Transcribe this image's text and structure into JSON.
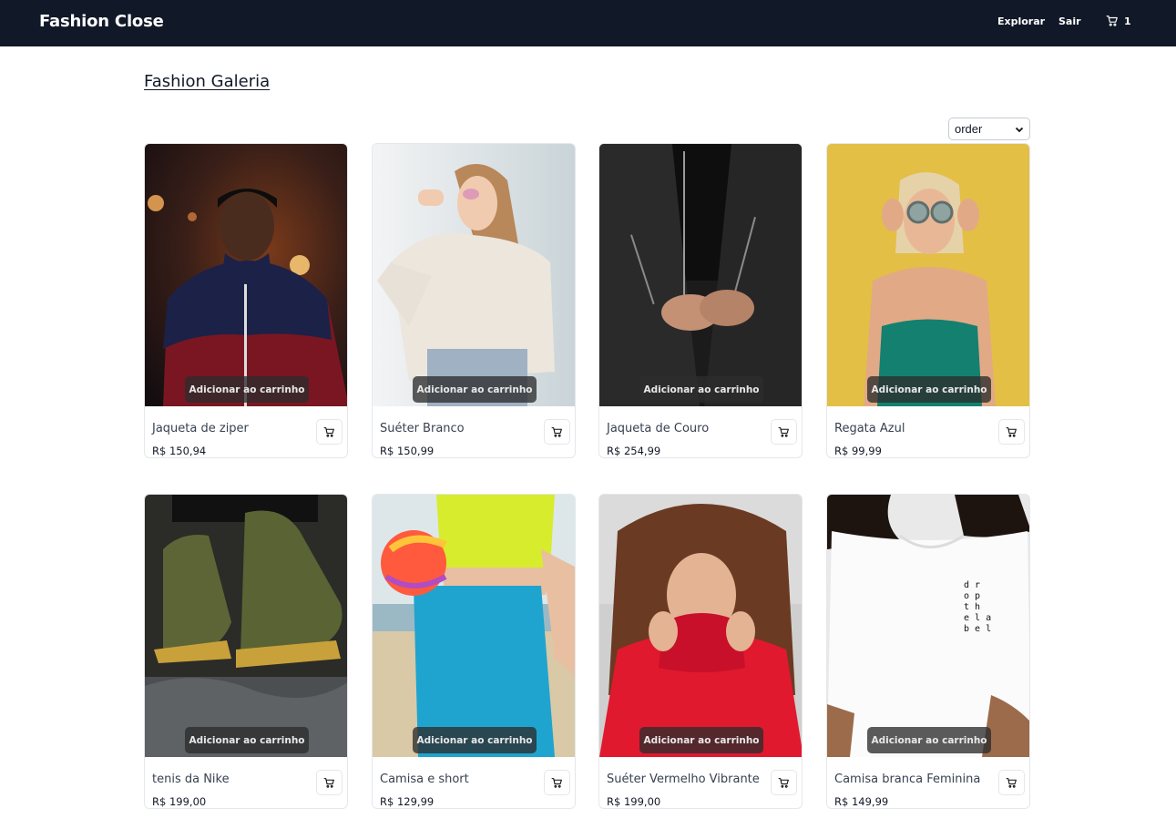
{
  "navbar": {
    "brand": "Fashion Close",
    "links": {
      "explore": "Explorar",
      "logout": "Sair"
    },
    "cart_count": "1"
  },
  "page": {
    "title": "Fashion Galeria",
    "order_select_value": "order"
  },
  "products": [
    {
      "name": "Jaqueta de ziper",
      "price": "R$ 150,94",
      "button": "Adicionar ao carrinho",
      "icon": "cart-icon"
    },
    {
      "name": "Suéter Branco",
      "price": "R$ 150,99",
      "button": "Adicionar ao carrinho",
      "icon": "cart-icon"
    },
    {
      "name": "Jaqueta de Couro",
      "price": "R$ 254,99",
      "button": "Adicionar ao carrinho",
      "icon": "cart-icon"
    },
    {
      "name": "Regata Azul",
      "price": "R$ 99,99",
      "button": "Adicionar ao carrinho",
      "icon": "cart-icon"
    },
    {
      "name": "tenis da Nike",
      "price": "R$ 199,00",
      "button": "Adicionar ao carrinho",
      "icon": "cart-icon"
    },
    {
      "name": "Camisa e short",
      "price": "R$ 129,99",
      "button": "Adicionar ao carrinho",
      "icon": "cart-icon"
    },
    {
      "name": "Suéter Vermelho Vibrante",
      "price": "R$ 199,00",
      "button": "Adicionar ao carrinho",
      "icon": "cart-icon"
    },
    {
      "name": "Camisa branca Feminina",
      "price": "R$ 149,99",
      "button": "Adicionar ao carrinho",
      "icon": "cart-icon"
    }
  ],
  "tshirt_print": "drop the label",
  "colors": {
    "navbar_bg": "#111827",
    "overlay_bg": "#2d2d2d"
  }
}
